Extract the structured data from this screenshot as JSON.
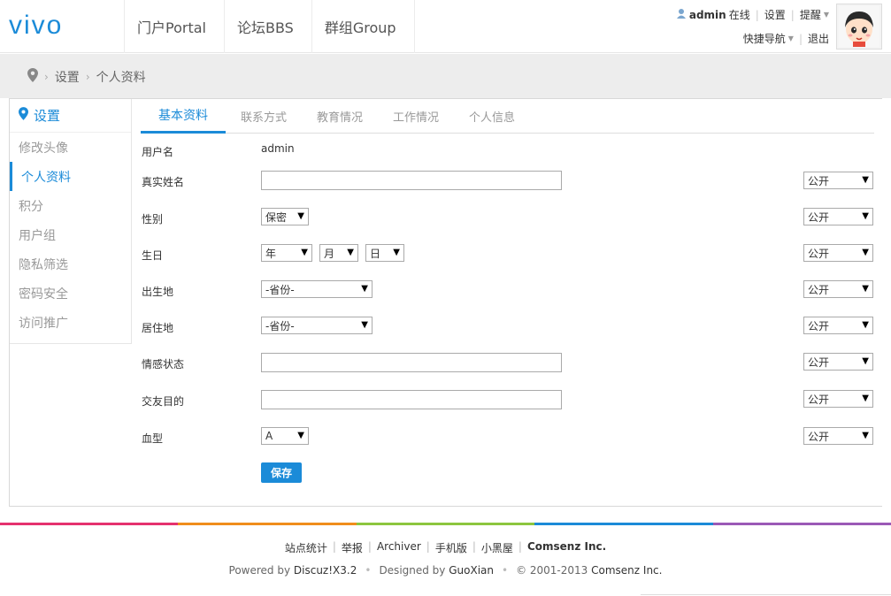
{
  "header": {
    "logo_text": "vivo",
    "nav": [
      "门户Portal",
      "论坛BBS",
      "群组Group"
    ],
    "user": {
      "name": "admin",
      "status": "在线",
      "settings": "设置",
      "remind": "提醒",
      "quicknav": "快捷导航",
      "logout": "退出"
    }
  },
  "breadcrumb": [
    "设置",
    "个人资料"
  ],
  "sidebar": {
    "title": "设置",
    "items": [
      "修改头像",
      "个人资料",
      "积分",
      "用户组",
      "隐私筛选",
      "密码安全",
      "访问推广"
    ],
    "active_index": 1
  },
  "tabs": [
    "基本资料",
    "联系方式",
    "教育情况",
    "工作情况",
    "个人信息"
  ],
  "form": {
    "username_label": "用户名",
    "username_value": "admin",
    "realname_label": "真实姓名",
    "gender_label": "性别",
    "gender_value": "保密",
    "birthday_label": "生日",
    "birth_year": "年",
    "birth_month": "月",
    "birth_day": "日",
    "birthplace_label": "出生地",
    "residence_label": "居住地",
    "province_placeholder": "-省份-",
    "affective_label": "情感状态",
    "lookingfor_label": "交友目的",
    "bloodtype_label": "血型",
    "bloodtype_value": "A",
    "privacy_value": "公开",
    "save_label": "保存"
  },
  "footer": {
    "links": [
      "站点统计",
      "举报",
      "Archiver",
      "手机版",
      "小黑屋",
      "Comsenz Inc."
    ],
    "powered_prefix": "Powered by",
    "powered_brand": "Discuz!X3.2",
    "designed_prefix": "Designed by",
    "designed_brand": "GuoXian",
    "copyright": "© 2001-2013",
    "copyright_brand": "Comsenz Inc."
  },
  "colors": {
    "accent": "#1b8bd8",
    "rainbow": [
      "#e5316e",
      "#f08d1c",
      "#8cc63f",
      "#1b8bd8",
      "#9b59b6"
    ]
  }
}
